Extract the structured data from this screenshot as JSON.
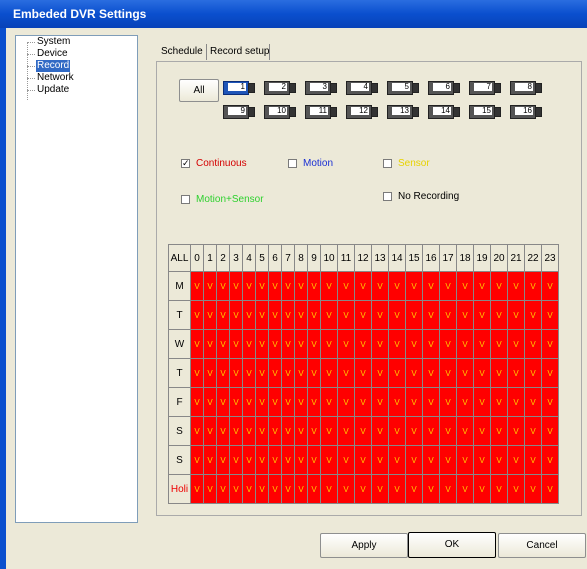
{
  "window": {
    "title": "Embeded DVR Settings"
  },
  "sidebar": {
    "items": [
      {
        "label": "System",
        "selected": false
      },
      {
        "label": "Device",
        "selected": false
      },
      {
        "label": "Record",
        "selected": true
      },
      {
        "label": "Network",
        "selected": false
      },
      {
        "label": "Update",
        "selected": false
      }
    ]
  },
  "tabs": [
    {
      "label": "Schedule",
      "active": true
    },
    {
      "label": "Record setup",
      "active": false
    }
  ],
  "all_button": "All",
  "cameras": [
    "1",
    "2",
    "3",
    "4",
    "5",
    "6",
    "7",
    "8",
    "9",
    "10",
    "11",
    "12",
    "13",
    "14",
    "15",
    "16"
  ],
  "selected_camera": "1",
  "record_modes": [
    {
      "label": "Continuous",
      "checked": true,
      "color": "#d40000"
    },
    {
      "label": "Motion",
      "checked": false,
      "color": "#1a2fd4"
    },
    {
      "label": "Sensor",
      "checked": false,
      "color": "#e8d200"
    },
    {
      "label": "Motion+Sensor",
      "checked": false,
      "color": "#2ed12e"
    },
    {
      "label": "No Recording",
      "checked": false,
      "color": "#000000"
    }
  ],
  "schedule": {
    "corner": "ALL",
    "hours": [
      "0",
      "1",
      "2",
      "3",
      "4",
      "5",
      "6",
      "7",
      "8",
      "9",
      "10",
      "11",
      "12",
      "13",
      "14",
      "15",
      "16",
      "17",
      "18",
      "19",
      "20",
      "21",
      "22",
      "23"
    ],
    "days": [
      "M",
      "T",
      "W",
      "T",
      "F",
      "S",
      "S",
      "Holi"
    ],
    "cell_mark": "V",
    "cell_color": "#ff0000"
  },
  "footer": {
    "apply": "Apply",
    "ok": "OK",
    "cancel": "Cancel"
  }
}
